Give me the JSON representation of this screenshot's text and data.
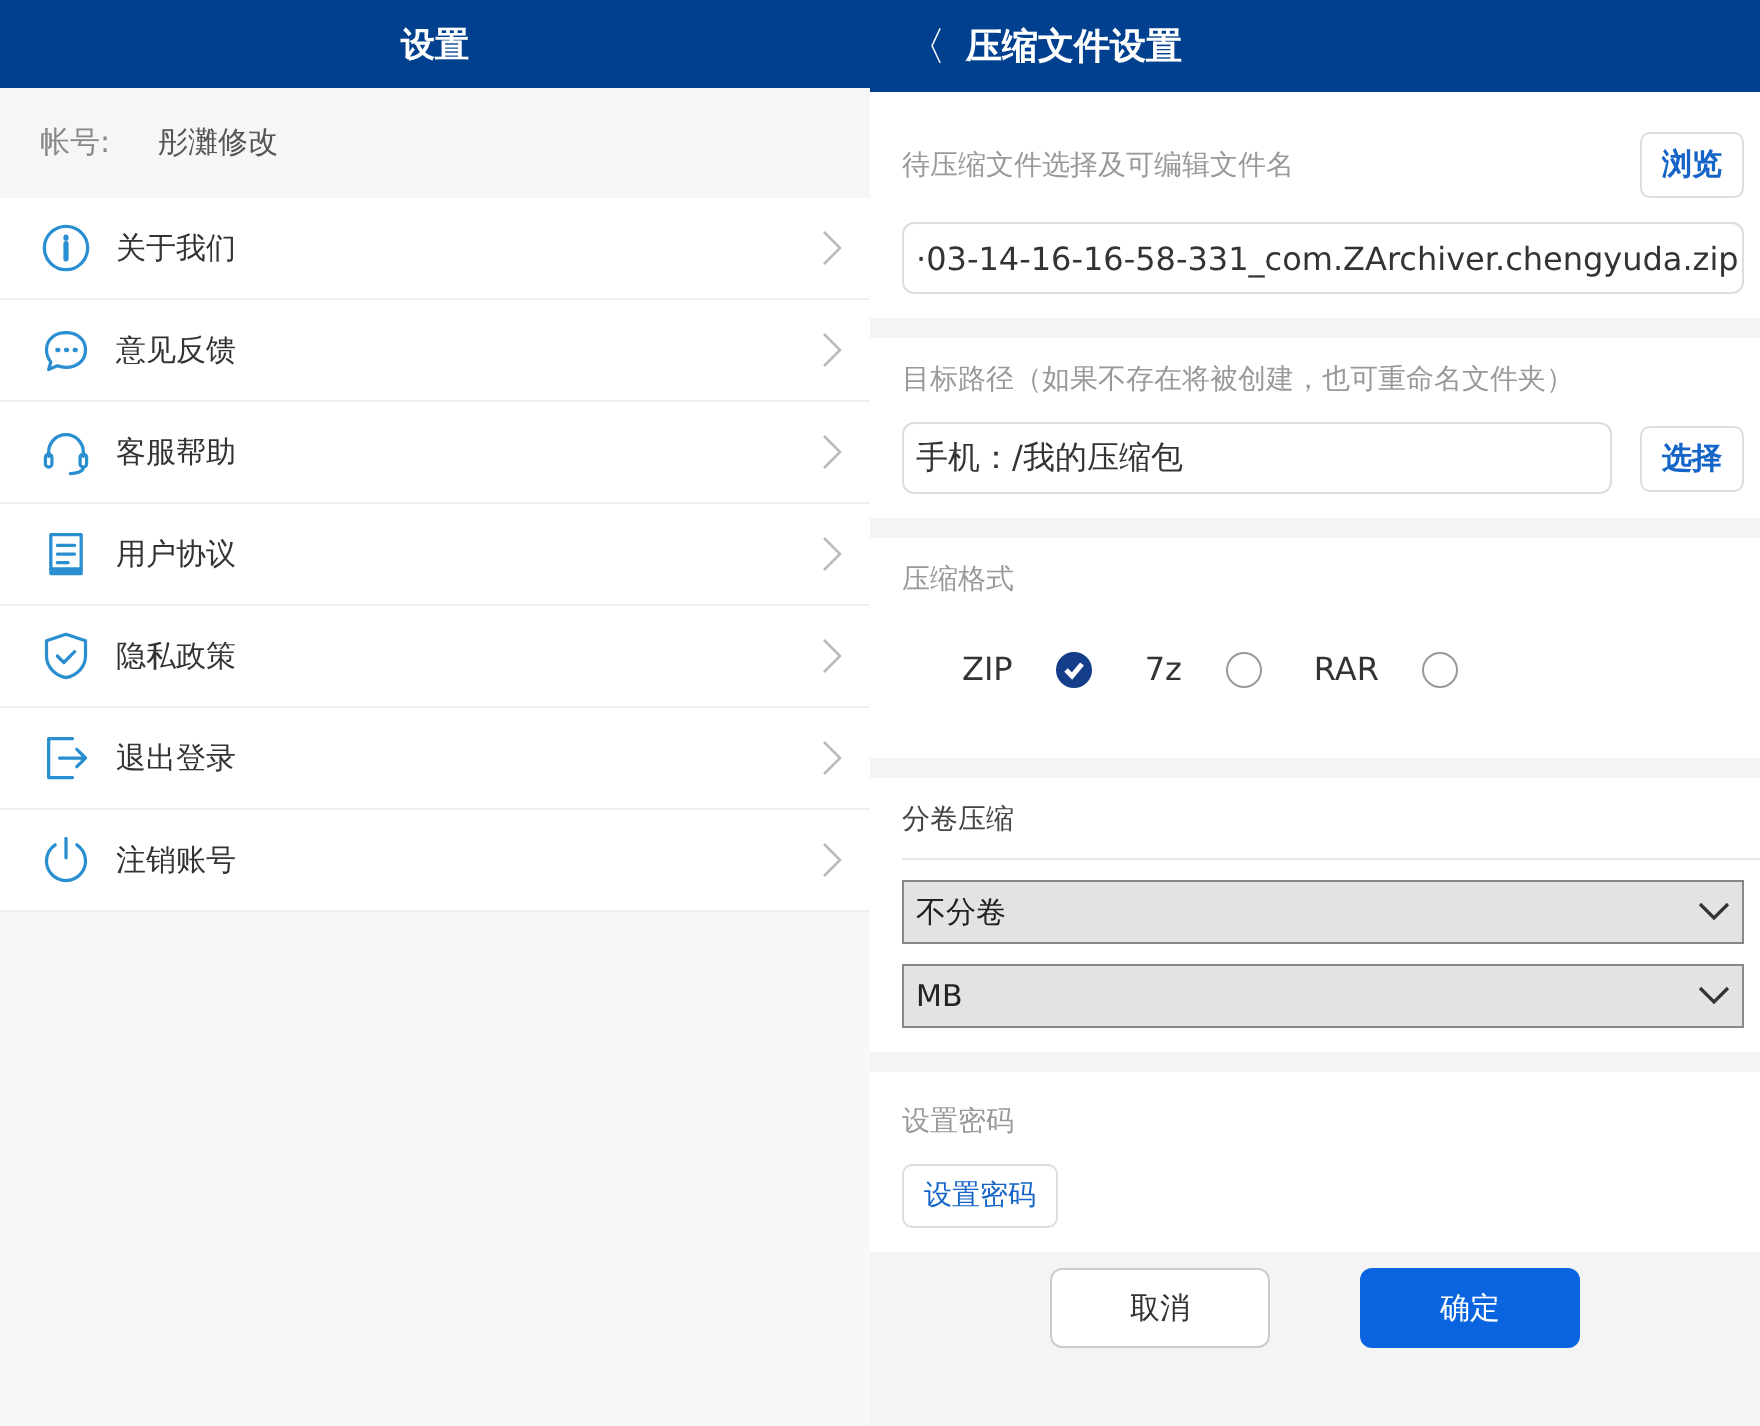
{
  "settings_screen": {
    "title": "设置",
    "account": {
      "label": "帐号:",
      "value": "彤灘修改"
    },
    "items": [
      {
        "kind": "info",
        "label": "关于我们"
      },
      {
        "kind": "chat",
        "label": "意见反馈"
      },
      {
        "kind": "headset",
        "label": "客服帮助"
      },
      {
        "kind": "document",
        "label": "用户协议"
      },
      {
        "kind": "shield",
        "label": "隐私政策"
      },
      {
        "kind": "logout",
        "label": "退出登录"
      },
      {
        "kind": "power",
        "label": "注销账号"
      }
    ]
  },
  "compress_screen": {
    "back": "〈",
    "title": "压缩文件设置",
    "file": {
      "label": "待压缩文件选择及可编辑文件名",
      "browse_button": "浏览",
      "value": "·03-14-16-16-58-331_com.ZArchiver.chengyuda.zip"
    },
    "target": {
      "label": "目标路径（如果不存在将被创建，也可重命名文件夹）",
      "value": "手机：/我的压缩包",
      "choose_button": "选择"
    },
    "format": {
      "label": "压缩格式",
      "options": [
        {
          "label": "ZIP",
          "selected": true
        },
        {
          "label": "7z",
          "selected": false
        },
        {
          "label": "RAR",
          "selected": false
        }
      ]
    },
    "split": {
      "label": "分卷压缩",
      "selects": [
        "不分卷",
        "MB"
      ]
    },
    "password": {
      "label": "设置密码",
      "button": "设置密码"
    },
    "buttons": [
      {
        "kind": "secondary",
        "label": "取消"
      },
      {
        "kind": "primary",
        "label": "确定"
      }
    ]
  }
}
